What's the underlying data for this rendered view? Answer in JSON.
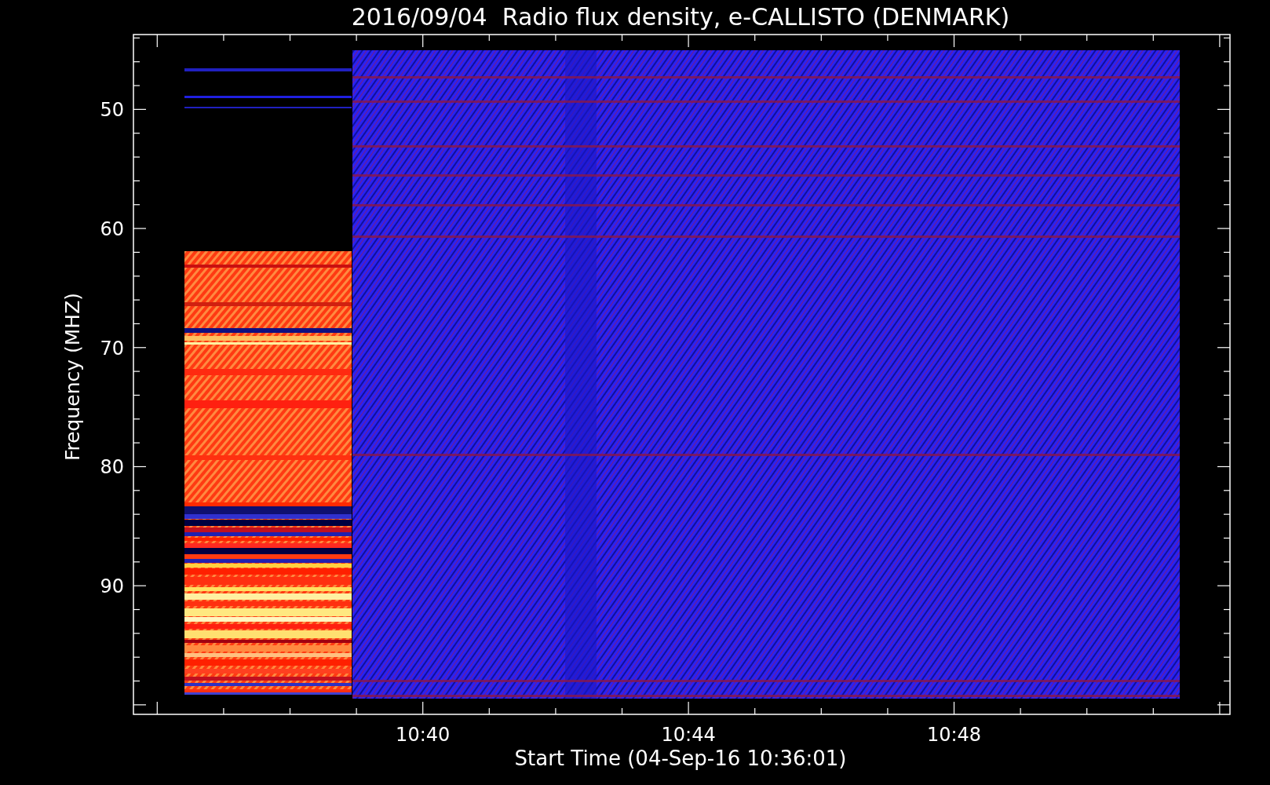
{
  "title": "2016/09/04  Radio flux density, e-CALLISTO (DENMARK)",
  "y_axis": {
    "label": "Frequency (MHZ)",
    "ticks": [
      "50",
      "60",
      "70",
      "80",
      "90"
    ]
  },
  "x_axis": {
    "label": "Start Time (04-Sep-16 10:36:01)",
    "ticks": [
      "10:40",
      "10:44",
      "10:48"
    ]
  }
}
